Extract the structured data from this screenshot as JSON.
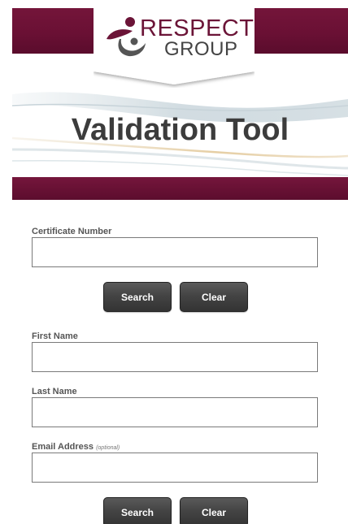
{
  "header": {
    "logo": {
      "word1": "RESPECT",
      "word2": "GROUP"
    },
    "title": "Validation Tool",
    "brand_color": "#6b1437"
  },
  "certificate_search": {
    "label": "Certificate Number",
    "value": "",
    "search_label": "Search",
    "clear_label": "Clear"
  },
  "name_search": {
    "first_name_label": "First Name",
    "first_name_value": "",
    "last_name_label": "Last Name",
    "last_name_value": "",
    "email_label": "Email Address",
    "email_optional_note": "(optional)",
    "email_value": "",
    "search_label": "Search",
    "clear_label": "Clear"
  }
}
